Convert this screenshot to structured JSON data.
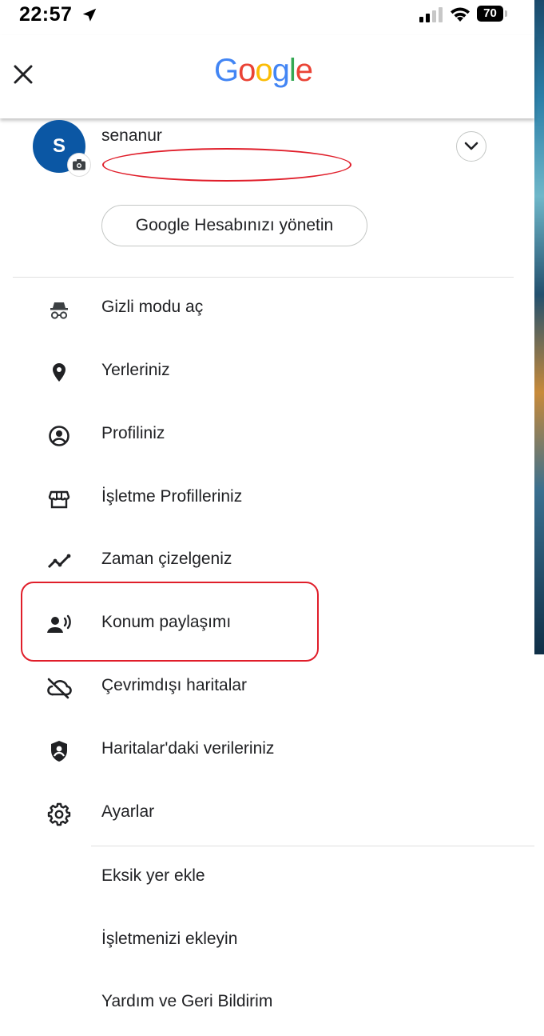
{
  "status_bar": {
    "time": "22:57",
    "battery": "70"
  },
  "header": {
    "logo_letters": [
      "G",
      "o",
      "o",
      "g",
      "l",
      "e"
    ]
  },
  "account": {
    "avatar_initial": "S",
    "name": "senanur",
    "manage_label": "Google Hesabınızı yönetin"
  },
  "menu": {
    "primary": [
      {
        "label": "Gizli modu aç",
        "icon": "incognito-icon"
      },
      {
        "label": "Yerleriniz",
        "icon": "location-pin-icon"
      },
      {
        "label": "Profiliniz",
        "icon": "account-circle-icon"
      },
      {
        "label": "İşletme Profilleriniz",
        "icon": "storefront-icon"
      },
      {
        "label": "Zaman çizelgeniz",
        "icon": "timeline-icon"
      },
      {
        "label": "Konum paylaşımı",
        "icon": "location-sharing-icon"
      },
      {
        "label": "Çevrimdışı haritalar",
        "icon": "cloud-off-icon"
      },
      {
        "label": "Haritalar'daki verileriniz",
        "icon": "shield-person-icon"
      },
      {
        "label": "Ayarlar",
        "icon": "gear-icon"
      }
    ],
    "secondary": [
      {
        "label": "Eksik yer ekle"
      },
      {
        "label": "İşletmenizi ekleyin"
      },
      {
        "label": "Yardım ve Geri Bildirim"
      }
    ]
  },
  "colors": {
    "accent_red": "#e01e2a",
    "avatar_blue": "#0b57a4"
  }
}
